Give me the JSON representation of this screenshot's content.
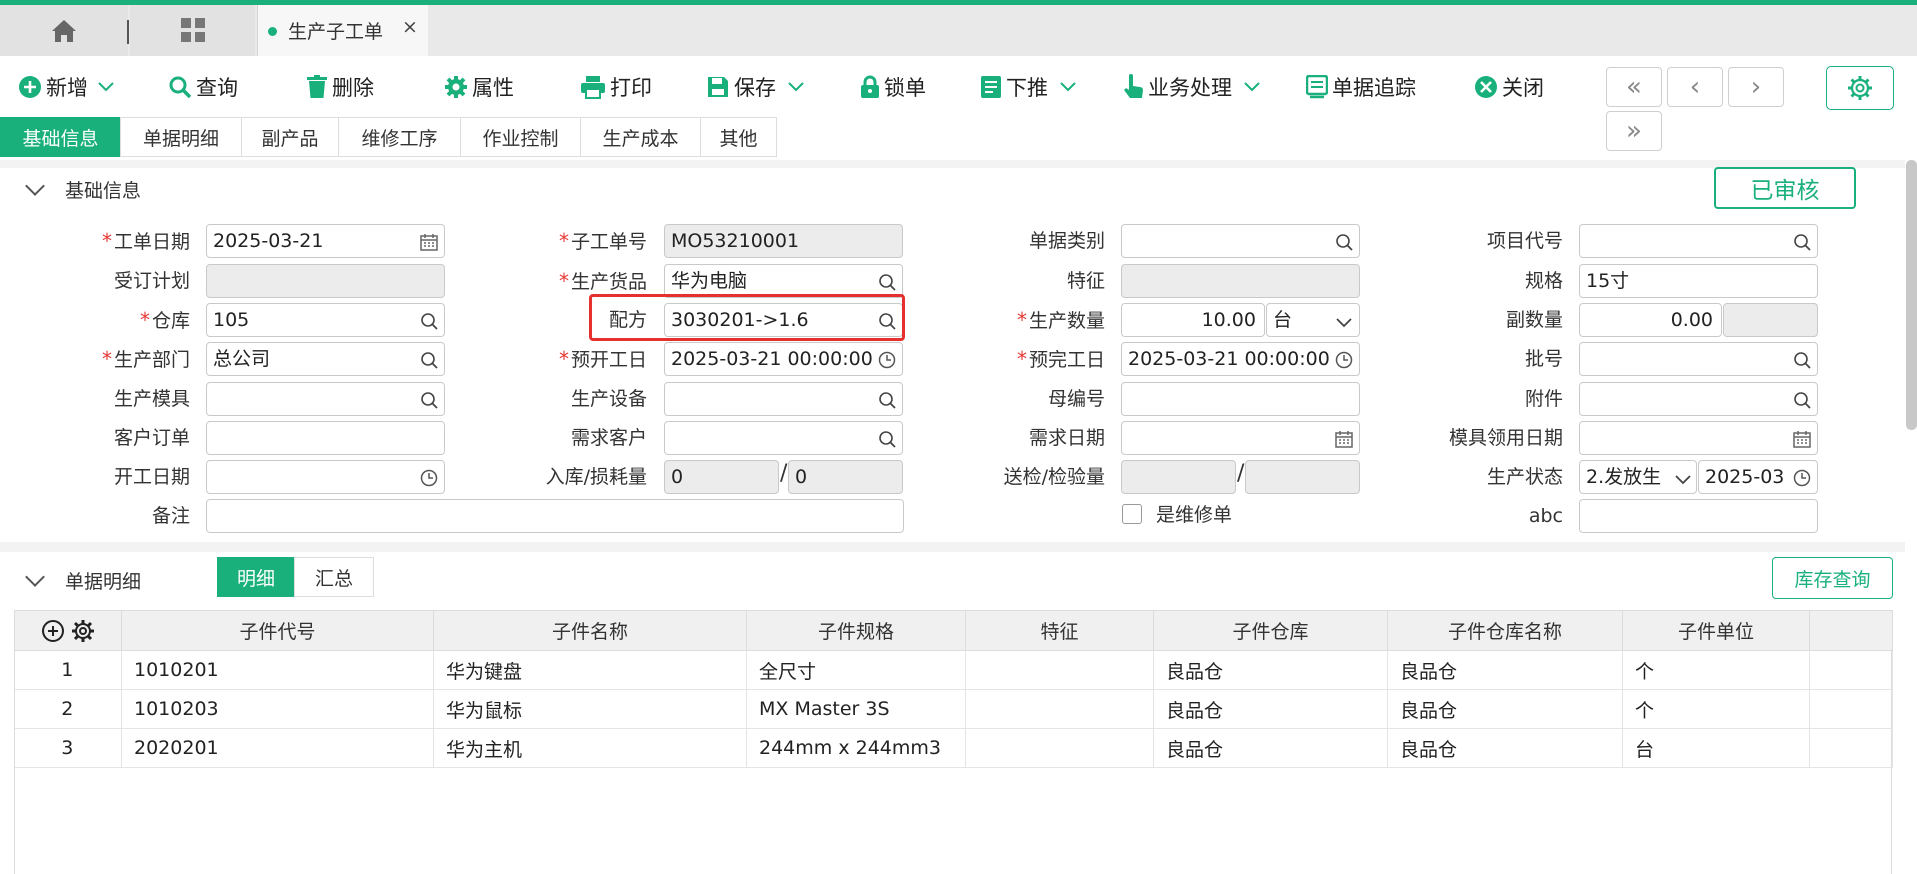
{
  "colors": {
    "accent": "#1ab07c",
    "highlight": "#e53030",
    "required": "#e53935"
  },
  "tabs": {
    "active_doc": "生产子工单",
    "close": "×"
  },
  "toolbar": {
    "add": "新增",
    "query": "查询",
    "delete": "删除",
    "properties": "属性",
    "print": "打印",
    "save": "保存",
    "lock": "锁单",
    "push_down": "下推",
    "business": "业务处理",
    "trace": "单据追踪",
    "close": "关闭",
    "nav_first": "«",
    "nav_prev": "‹",
    "nav_next": "›",
    "nav_last": "»"
  },
  "subtabs": [
    "基础信息",
    "单据明细",
    "副产品",
    "维修工序",
    "作业控制",
    "生产成本",
    "其他"
  ],
  "section_basic": {
    "title": "基础信息",
    "status": "已审核"
  },
  "form": {
    "work_date": {
      "label": "工单日期",
      "value": "2025-03-21"
    },
    "order_plan": {
      "label": "受订计划",
      "value": ""
    },
    "warehouse": {
      "label": "仓库",
      "value": "105"
    },
    "department": {
      "label": "生产部门",
      "value": "总公司"
    },
    "mold": {
      "label": "生产模具",
      "value": ""
    },
    "customer_order": {
      "label": "客户订单",
      "value": ""
    },
    "start_date": {
      "label": "开工日期",
      "value": ""
    },
    "remark": {
      "label": "备注",
      "value": ""
    },
    "sub_order_no": {
      "label": "子工单号",
      "value": "MO53210001"
    },
    "product": {
      "label": "生产货品",
      "value": "华为电脑"
    },
    "formula": {
      "label": "配方",
      "value": "3030201->1.6"
    },
    "planned_start": {
      "label": "预开工日",
      "value": "2025-03-21 00:00:00"
    },
    "equipment": {
      "label": "生产设备",
      "value": ""
    },
    "demand_customer": {
      "label": "需求客户",
      "value": ""
    },
    "in_loss": {
      "label": "入库/损耗量",
      "value1": "0",
      "value2": "0",
      "sep": "/"
    },
    "doc_type": {
      "label": "单据类别",
      "value": ""
    },
    "feature": {
      "label": "特征",
      "value": ""
    },
    "quantity": {
      "label": "生产数量",
      "value": "10.00",
      "unit": "台"
    },
    "planned_end": {
      "label": "预完工日",
      "value": "2025-03-21 00:00:00"
    },
    "parent_no": {
      "label": "母编号",
      "value": ""
    },
    "demand_date": {
      "label": "需求日期",
      "value": ""
    },
    "inspect_qty": {
      "label": "送检/检验量",
      "value1": "",
      "value2": "",
      "sep": "/"
    },
    "is_repair": {
      "label": "是维修单",
      "checked": false
    },
    "project_code": {
      "label": "项目代号",
      "value": ""
    },
    "spec": {
      "label": "规格",
      "value": "15寸"
    },
    "sub_qty": {
      "label": "副数量",
      "value": "0.00",
      "value2": ""
    },
    "batch": {
      "label": "批号",
      "value": ""
    },
    "attachment": {
      "label": "附件",
      "value": ""
    },
    "mold_date": {
      "label": "模具领用日期",
      "value": ""
    },
    "prod_status": {
      "label": "生产状态",
      "value": "2.发放生",
      "date": "2025-03"
    },
    "abc": {
      "label": "abc",
      "value": ""
    },
    "required_mark": "*"
  },
  "section_detail": {
    "title": "单据明细",
    "seg_detail": "明细",
    "seg_summary": "汇总",
    "stock_query": "库存查询"
  },
  "table": {
    "columns": [
      "子件代号",
      "子件名称",
      "子件规格",
      "特征",
      "子件仓库",
      "子件仓库名称",
      "子件单位"
    ],
    "rows": [
      {
        "idx": "1",
        "code": "1010201",
        "name": "华为键盘",
        "spec": "全尺寸",
        "feature": "",
        "wh": "良品仓",
        "wh_name": "良品仓",
        "unit": "个"
      },
      {
        "idx": "2",
        "code": "1010203",
        "name": "华为鼠标",
        "spec": "MX Master 3S",
        "feature": "",
        "wh": "良品仓",
        "wh_name": "良品仓",
        "unit": "个"
      },
      {
        "idx": "3",
        "code": "2020201",
        "name": "华为主机",
        "spec": "244mm x 244mm3",
        "feature": "",
        "wh": "良品仓",
        "wh_name": "良品仓",
        "unit": "台"
      }
    ]
  }
}
